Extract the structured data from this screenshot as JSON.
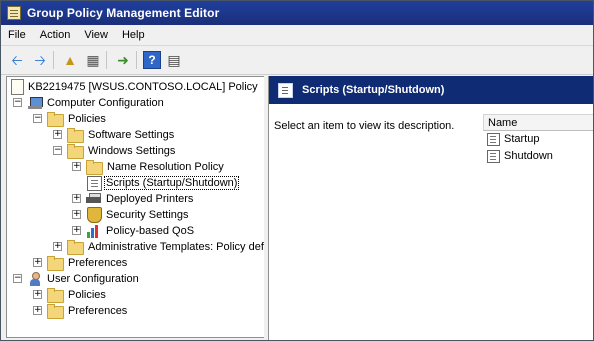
{
  "window": {
    "title": "Group Policy Management Editor"
  },
  "menu": [
    "File",
    "Action",
    "View",
    "Help"
  ],
  "toolbar": {
    "back_icon": "back-arrow-icon",
    "forward_icon": "forward-arrow-icon",
    "up_icon": "up-folder-icon",
    "show_hide_icon": "show-hide-tree-icon",
    "export_icon": "export-list-icon",
    "help_icon": "help-icon",
    "properties_icon": "properties-icon"
  },
  "tree": {
    "items": [
      {
        "label": "KB2219475 [WSUS.CONTOSO.LOCAL] Policy",
        "icon": "policy-document-icon",
        "level": 0,
        "expander": ""
      },
      {
        "label": "Computer Configuration",
        "icon": "computer-icon",
        "level": 0,
        "expander": "−"
      },
      {
        "label": "Policies",
        "icon": "folder-icon",
        "level": 1,
        "expander": "−"
      },
      {
        "label": "Software Settings",
        "icon": "folder-icon",
        "level": 2,
        "expander": "+"
      },
      {
        "label": "Windows Settings",
        "icon": "folder-icon",
        "level": 2,
        "expander": "−"
      },
      {
        "label": "Name Resolution Policy",
        "icon": "folder-icon",
        "level": 3,
        "expander": "+"
      },
      {
        "label": "Scripts (Startup/Shutdown)",
        "icon": "script-icon",
        "level": 3,
        "expander": "",
        "selected": true
      },
      {
        "label": "Deployed Printers",
        "icon": "printer-icon",
        "level": 3,
        "expander": "+"
      },
      {
        "label": "Security Settings",
        "icon": "shield-icon",
        "level": 3,
        "expander": "+"
      },
      {
        "label": "Policy-based QoS",
        "icon": "qos-chart-icon",
        "level": 3,
        "expander": "+"
      },
      {
        "label": "Administrative Templates: Policy defi",
        "icon": "folder-icon",
        "level": 2,
        "expander": "+"
      },
      {
        "label": "Preferences",
        "icon": "folder-icon",
        "level": 1,
        "expander": "+"
      },
      {
        "label": "User Configuration",
        "icon": "user-icon",
        "level": 0,
        "expander": "−"
      },
      {
        "label": "Policies",
        "icon": "folder-icon",
        "level": 1,
        "expander": "+"
      },
      {
        "label": "Preferences",
        "icon": "folder-icon",
        "level": 1,
        "expander": "+"
      }
    ]
  },
  "details": {
    "header_title": "Scripts (Startup/Shutdown)",
    "description": "Select an item to view its description.",
    "column_name": "Name",
    "items": [
      "Startup",
      "Shutdown"
    ]
  }
}
